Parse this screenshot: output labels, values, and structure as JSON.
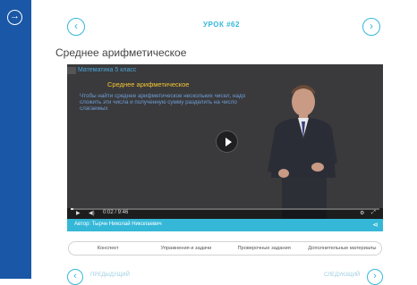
{
  "sidebar": {
    "toggle_icon": "arrow-right-circle-icon"
  },
  "header": {
    "prev_icon": "‹",
    "next_icon": "›",
    "lesson_label": "УРОК #62"
  },
  "page": {
    "title": "Среднее арифметическое"
  },
  "video": {
    "board_course": "Математика 5 класс",
    "board_topic": "Среднее арифметическое",
    "board_text": "Чтобы найти среднее арифметическое нескольких чисел, надо сложить эти числа и полученную сумму разделить на число слагаемых",
    "time": "0:02 / 9:46",
    "progress": 0.01,
    "author": "Автор: Тырчн Николай Николаевич"
  },
  "tabs": [
    "Конспект",
    "Упражнения и задачи",
    "Проверочные задания",
    "Дополнительные материалы"
  ],
  "footer": {
    "prev_label": "ПРЕДЫДУЩИЙ",
    "next_label": "СЛЕДУЮЩИЙ"
  },
  "colors": {
    "sidebar": "#1a57a6",
    "accent": "#35b8d8",
    "video_bg": "#3a3a3d"
  }
}
